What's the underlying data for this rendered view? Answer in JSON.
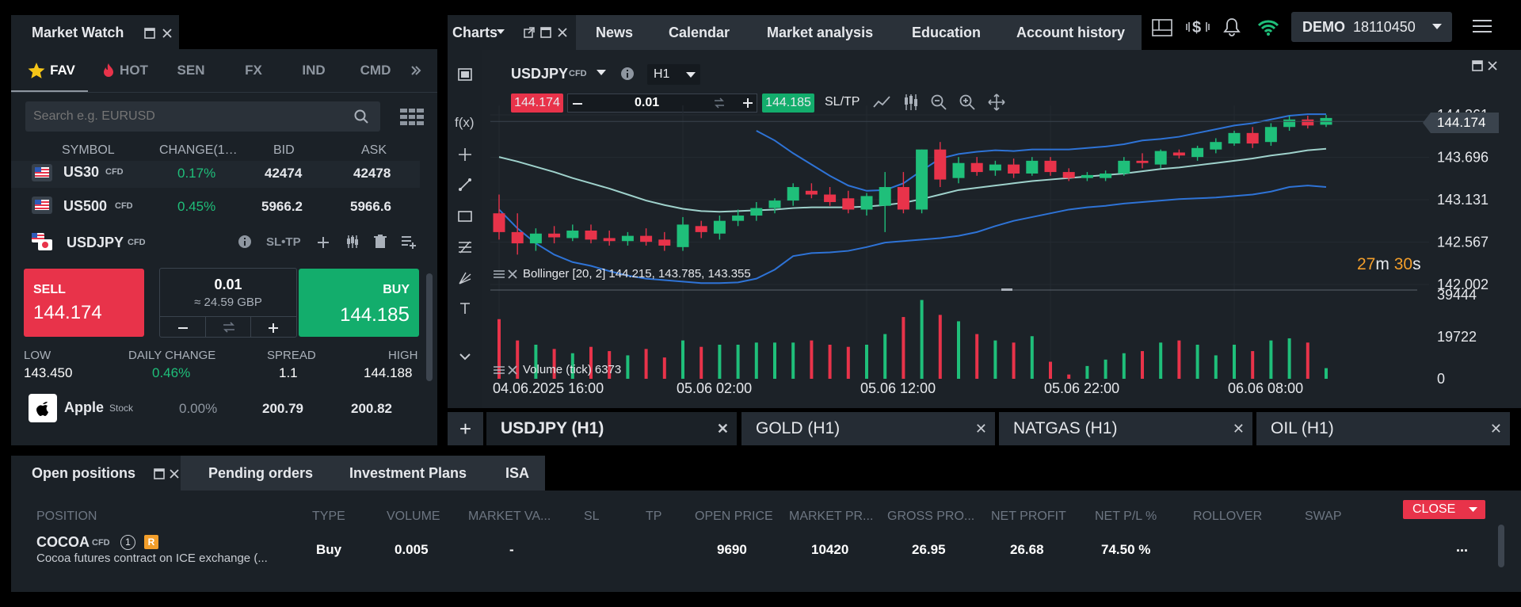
{
  "market_watch": {
    "title": "Market Watch",
    "tabs": [
      "FAV",
      "HOT",
      "SEN",
      "FX",
      "IND",
      "CMD"
    ],
    "search_placeholder": "Search e.g. EURUSD",
    "columns": [
      "SYMBOL",
      "CHANGE(1…",
      "BID",
      "ASK"
    ],
    "rows": [
      {
        "symbol": "US30",
        "tag": "CFD",
        "change": "0.17%",
        "bid": "42474",
        "ask": "42478"
      },
      {
        "symbol": "US500",
        "tag": "CFD",
        "change": "0.45%",
        "bid": "5966.2",
        "ask": "5966.6"
      }
    ],
    "selected": {
      "symbol": "USDJPY",
      "tag": "CFD",
      "sltp": "SL•TP",
      "sell_label": "SELL",
      "sell_price": "144.174",
      "buy_label": "BUY",
      "buy_price_main": "144.18",
      "buy_price_last": "5",
      "volume": "0.01",
      "volume_value": "≈ 24.59 GBP",
      "stats": {
        "low_label": "LOW",
        "low": "143.450",
        "change_label": "DAILY CHANGE",
        "change": "0.46%",
        "spread_label": "SPREAD",
        "spread": "1.1",
        "high_label": "HIGH",
        "high": "144.188"
      }
    },
    "last_row": {
      "symbol": "Apple",
      "tag": "Stock",
      "change": "0.00%",
      "bid": "200.79",
      "ask": "200.82"
    }
  },
  "top_nav": {
    "charts": "Charts",
    "tabs": [
      "News",
      "Calendar",
      "Market analysis",
      "Education",
      "Account history"
    ],
    "account_mode": "DEMO",
    "account_number": "18110450"
  },
  "chart": {
    "symbol": "USDJPY",
    "tag": "CFD",
    "timeframe": "H1",
    "sell_price": "144.174",
    "volume": "0.01",
    "buy_price": "144.185",
    "sltp": "SL/TP",
    "current_price": "144.174",
    "countdown_min": "27",
    "countdown_min_unit": "m",
    "countdown_sec": "30",
    "countdown_sec_unit": "s",
    "bollinger_label": "Bollinger [20, 2] 144.215, 143.785, 143.355",
    "volume_label": "Volume (tick) 6373",
    "fx_label": "f(x)"
  },
  "chart_data": {
    "type": "candlestick",
    "x_ticks": [
      "04.06.2025 16:00",
      "05.06 02:00",
      "05.06 12:00",
      "05.06 22:00",
      "06.06 08:00"
    ],
    "y_ticks": [
      "144.261",
      "143.696",
      "143.131",
      "142.567",
      "142.002"
    ],
    "ylim": [
      142.002,
      144.261
    ],
    "volume_ticks": [
      "39444",
      "19722",
      "0"
    ],
    "volume_ylim": [
      0,
      39444
    ],
    "colors": {
      "up": "#1fbf7a",
      "down": "#e8334a",
      "band": "#2e73d6",
      "middle": "#9fd2cc"
    },
    "candles": [
      {
        "o": 142.95,
        "h": 143.2,
        "l": 142.6,
        "c": 142.7
      },
      {
        "o": 142.7,
        "h": 142.95,
        "l": 142.4,
        "c": 142.55
      },
      {
        "o": 142.55,
        "h": 142.75,
        "l": 142.45,
        "c": 142.68
      },
      {
        "o": 142.68,
        "h": 142.78,
        "l": 142.55,
        "c": 142.63
      },
      {
        "o": 142.62,
        "h": 142.8,
        "l": 142.58,
        "c": 142.72
      },
      {
        "o": 142.72,
        "h": 142.8,
        "l": 142.55,
        "c": 142.6
      },
      {
        "o": 142.62,
        "h": 142.72,
        "l": 142.52,
        "c": 142.58
      },
      {
        "o": 142.58,
        "h": 142.7,
        "l": 142.52,
        "c": 142.65
      },
      {
        "o": 142.65,
        "h": 142.75,
        "l": 142.52,
        "c": 142.57
      },
      {
        "o": 142.6,
        "h": 142.7,
        "l": 142.45,
        "c": 142.52
      },
      {
        "o": 142.5,
        "h": 142.9,
        "l": 142.45,
        "c": 142.8
      },
      {
        "o": 142.78,
        "h": 142.85,
        "l": 142.62,
        "c": 142.7
      },
      {
        "o": 142.68,
        "h": 142.92,
        "l": 142.6,
        "c": 142.85
      },
      {
        "o": 142.85,
        "h": 143.0,
        "l": 142.78,
        "c": 142.92
      },
      {
        "o": 142.92,
        "h": 143.1,
        "l": 142.85,
        "c": 143.02
      },
      {
        "o": 143.02,
        "h": 143.15,
        "l": 142.95,
        "c": 143.12
      },
      {
        "o": 143.12,
        "h": 143.35,
        "l": 143.05,
        "c": 143.3
      },
      {
        "o": 143.25,
        "h": 143.35,
        "l": 143.15,
        "c": 143.2
      },
      {
        "o": 143.2,
        "h": 143.3,
        "l": 143.05,
        "c": 143.1
      },
      {
        "o": 143.15,
        "h": 143.25,
        "l": 142.95,
        "c": 143.0
      },
      {
        "o": 143.0,
        "h": 143.22,
        "l": 142.92,
        "c": 143.18
      },
      {
        "o": 143.05,
        "h": 143.5,
        "l": 142.7,
        "c": 143.3
      },
      {
        "o": 143.3,
        "h": 143.5,
        "l": 142.95,
        "c": 143.0
      },
      {
        "o": 143.0,
        "h": 143.8,
        "l": 142.95,
        "c": 143.8
      },
      {
        "o": 143.8,
        "h": 143.9,
        "l": 143.3,
        "c": 143.4
      },
      {
        "o": 143.42,
        "h": 143.7,
        "l": 143.35,
        "c": 143.62
      },
      {
        "o": 143.62,
        "h": 143.7,
        "l": 143.45,
        "c": 143.5
      },
      {
        "o": 143.52,
        "h": 143.65,
        "l": 143.45,
        "c": 143.6
      },
      {
        "o": 143.6,
        "h": 143.68,
        "l": 143.42,
        "c": 143.48
      },
      {
        "o": 143.48,
        "h": 143.7,
        "l": 143.45,
        "c": 143.65
      },
      {
        "o": 143.65,
        "h": 143.7,
        "l": 143.45,
        "c": 143.5
      },
      {
        "o": 143.5,
        "h": 143.55,
        "l": 143.38,
        "c": 143.42
      },
      {
        "o": 143.42,
        "h": 143.5,
        "l": 143.38,
        "c": 143.46
      },
      {
        "o": 143.42,
        "h": 143.52,
        "l": 143.38,
        "c": 143.48
      },
      {
        "o": 143.48,
        "h": 143.7,
        "l": 143.45,
        "c": 143.65
      },
      {
        "o": 143.65,
        "h": 143.75,
        "l": 143.55,
        "c": 143.62
      },
      {
        "o": 143.6,
        "h": 143.8,
        "l": 143.55,
        "c": 143.78
      },
      {
        "o": 143.76,
        "h": 143.8,
        "l": 143.68,
        "c": 143.72
      },
      {
        "o": 143.7,
        "h": 143.85,
        "l": 143.65,
        "c": 143.82
      },
      {
        "o": 143.8,
        "h": 143.95,
        "l": 143.75,
        "c": 143.9
      },
      {
        "o": 143.88,
        "h": 144.05,
        "l": 143.85,
        "c": 144.02
      },
      {
        "o": 144.02,
        "h": 144.1,
        "l": 143.82,
        "c": 143.88
      },
      {
        "o": 143.9,
        "h": 144.15,
        "l": 143.85,
        "c": 144.1
      },
      {
        "o": 144.1,
        "h": 144.25,
        "l": 144.05,
        "c": 144.2
      },
      {
        "o": 144.2,
        "h": 144.25,
        "l": 144.08,
        "c": 144.12
      },
      {
        "o": 144.13,
        "h": 144.26,
        "l": 144.1,
        "c": 144.22
      }
    ],
    "volume": [
      28000,
      18000,
      16000,
      14000,
      12000,
      15000,
      13000,
      11000,
      14000,
      10000,
      18000,
      15000,
      16000,
      16000,
      17000,
      17000,
      17000,
      18000,
      16000,
      15000,
      16000,
      21000,
      29000,
      37000,
      30000,
      27000,
      21000,
      18000,
      17000,
      20000,
      8000,
      2000,
      6000,
      9000,
      12000,
      13000,
      17000,
      18000,
      16000,
      11000,
      16000,
      13000,
      18000,
      19000,
      17000,
      5000
    ],
    "bollinger": {
      "upper": [
        null,
        null,
        null,
        null,
        null,
        null,
        null,
        null,
        null,
        null,
        null,
        null,
        null,
        null,
        144.05,
        143.92,
        143.75,
        143.6,
        143.45,
        143.32,
        143.25,
        143.26,
        143.35,
        143.52,
        143.68,
        143.74,
        143.77,
        143.79,
        143.78,
        143.8,
        143.8,
        143.8,
        143.82,
        143.84,
        143.87,
        143.92,
        143.94,
        143.97,
        144.02,
        144.07,
        144.12,
        144.15,
        144.2,
        144.25,
        144.27,
        144.27
      ],
      "middle": [
        143.7,
        143.64,
        143.57,
        143.5,
        143.42,
        143.35,
        143.28,
        143.2,
        143.12,
        143.06,
        143.01,
        142.98,
        142.97,
        142.98,
        142.99,
        143.0,
        143.02,
        143.03,
        143.03,
        143.03,
        143.04,
        143.06,
        143.09,
        143.14,
        143.2,
        143.26,
        143.29,
        143.32,
        143.35,
        143.38,
        143.4,
        143.42,
        143.44,
        143.46,
        143.48,
        143.51,
        143.54,
        143.56,
        143.59,
        143.62,
        143.65,
        143.68,
        143.72,
        143.75,
        143.79,
        143.81
      ],
      "lower": [
        143.0,
        142.75,
        142.55,
        142.4,
        142.3,
        142.25,
        142.18,
        142.12,
        142.08,
        142.06,
        142.04,
        142.02,
        142.02,
        142.03,
        142.08,
        142.2,
        142.38,
        142.42,
        142.43,
        142.45,
        142.5,
        142.56,
        142.58,
        142.6,
        142.62,
        142.65,
        142.7,
        142.78,
        142.85,
        142.9,
        142.95,
        143.0,
        143.03,
        143.05,
        143.08,
        143.1,
        143.12,
        143.14,
        143.15,
        143.16,
        143.18,
        143.2,
        143.24,
        143.3,
        143.32,
        143.3
      ]
    }
  },
  "chart_tabs": {
    "plus": "+",
    "tabs": [
      "USDJPY (H1)",
      "GOLD (H1)",
      "NATGAS (H1)",
      "OIL (H1)"
    ]
  },
  "positions": {
    "tabs": [
      "Open positions",
      "Pending orders",
      "Investment Plans",
      "ISA"
    ],
    "columns": [
      "POSITION",
      "TYPE",
      "VOLUME",
      "MARKET VA...",
      "SL",
      "TP",
      "OPEN PRICE",
      "MARKET PR...",
      "GROSS PRO...",
      "NET PROFIT",
      "NET P/L %",
      "ROLLOVER",
      "SWAP"
    ],
    "close_label": "CLOSE",
    "row": {
      "symbol": "COCOA",
      "tag": "CFD",
      "count": "1",
      "badge": "R",
      "description": "Cocoa futures contract on ICE exchange (...",
      "type": "Buy",
      "volume": "0.005",
      "market_value": "-",
      "open_price": "9690",
      "market_price": "10420",
      "gross_profit": "26.95",
      "net_profit": "26.68",
      "net_pl_pct": "74.50 %",
      "more": "..."
    }
  }
}
